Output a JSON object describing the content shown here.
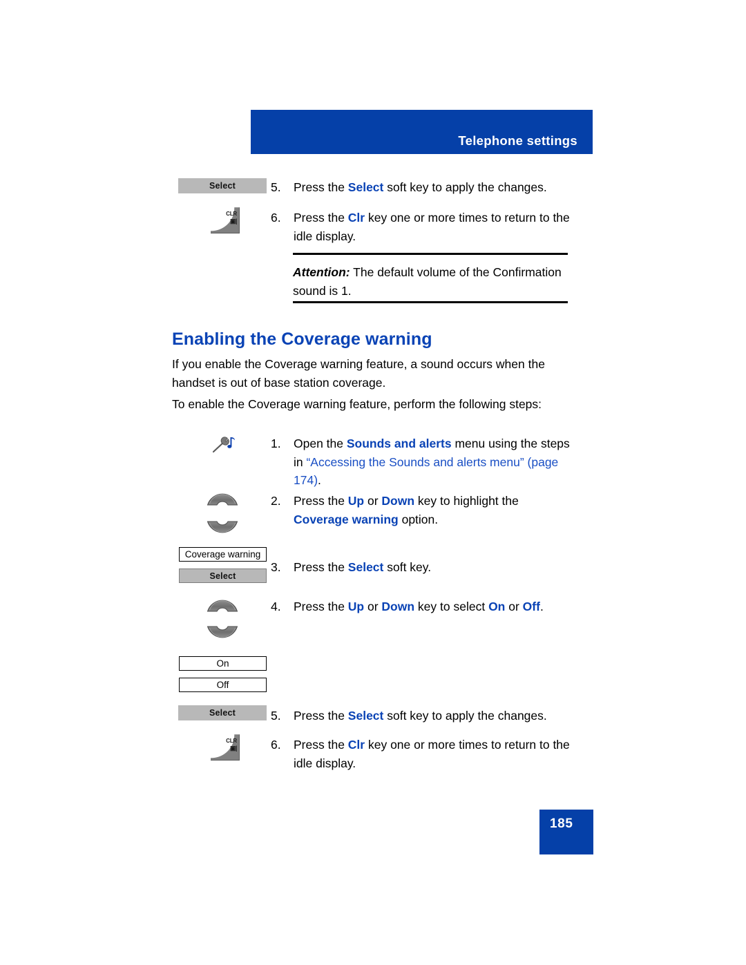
{
  "header": {
    "title": "Telephone settings",
    "banner_color": "#0540a8"
  },
  "top_steps": [
    {
      "number": "5.",
      "icon": "select-softkey",
      "icon_label": "Select",
      "text_parts": [
        {
          "t": "Press the ",
          "style": "normal"
        },
        {
          "t": "Select",
          "style": "blue-bold"
        },
        {
          "t": " soft key to apply the changes.",
          "style": "normal"
        }
      ],
      "plain": "Press the Select soft key to apply the changes."
    },
    {
      "number": "6.",
      "icon": "clr-key",
      "icon_label": "CLR",
      "plain": "Press the Clr key one or more times to return to the idle display."
    }
  ],
  "attention": {
    "label": "Attention:",
    "text": " The default volume of the Confirmation sound is 1."
  },
  "heading": "Enabling the Coverage warning",
  "paragraphs": [
    "If you enable the Coverage warning feature, a sound occurs when the handset is out of base station coverage.",
    "To enable the Coverage warning feature, perform the following steps:"
  ],
  "steps": [
    {
      "number": "1.",
      "icon": "sounds-and-alerts-icon",
      "line1_a": "Open the ",
      "line1_bold": "Sounds and alerts",
      "line1_b": " menu using the steps",
      "line2_a": "in ",
      "line2_link": "“Accessing the Sounds and alerts menu”",
      "line3_link": "(page 174)",
      "line3_b": "."
    },
    {
      "number": "2.",
      "icon": "up-down-rocker",
      "line1_a": "Press the ",
      "line1_up": "Up",
      "line1_mid": " or ",
      "line1_down": "Down",
      "line1_b": " key to highlight the",
      "line2_bold": "Coverage warning",
      "line2_b": " option."
    },
    {
      "number": "3.",
      "icon": "select-softkey",
      "menu_item": "Coverage warning",
      "softkey": "Select",
      "line1_a": "Press the ",
      "line1_bold": "Select",
      "line1_b": " soft key."
    },
    {
      "number": "4.",
      "icon": "up-down-rocker",
      "options": [
        "On",
        "Off"
      ],
      "line1_a": "Press the ",
      "line1_up": "Up",
      "line1_mid": " or ",
      "line1_down": "Down",
      "line1_c": " key to select ",
      "line1_on": "On",
      "line1_mid2": " or ",
      "line1_off": "Off",
      "line1_end": "."
    },
    {
      "number": "5.",
      "icon": "select-softkey",
      "icon_label": "Select",
      "line1_a": "Press the ",
      "line1_bold": "Select",
      "line1_b": " soft key to apply the changes."
    },
    {
      "number": "6.",
      "icon": "clr-key",
      "icon_label": "CLR",
      "line1_a": "Press the ",
      "line1_bold": "Clr",
      "line1_b": " key one or more times to return to the",
      "line2": "idle display."
    }
  ],
  "page_number": "185",
  "colors": {
    "accent_blue": "#0540a8",
    "text_blue": "#0a43b5",
    "link_blue": "#1a4fc4",
    "key_gray": "#808080",
    "softkey_gray": "#b8b8b8"
  }
}
